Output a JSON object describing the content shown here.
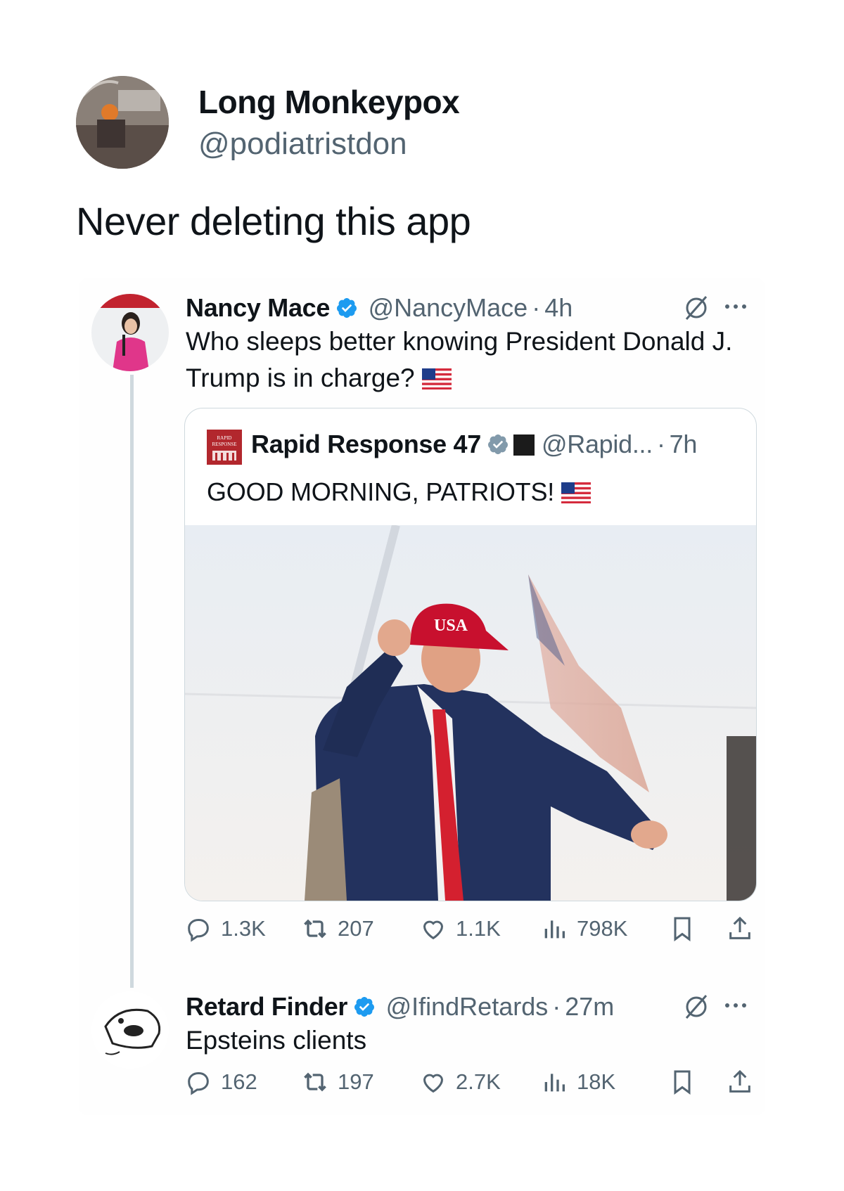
{
  "outer": {
    "display_name": "Long Monkeypox",
    "handle": "@podiatristdon",
    "text": "Never deleting this app"
  },
  "tweet1": {
    "display_name": "Nancy Mace",
    "handle": "@NancyMace",
    "time": "4h",
    "separator": "·",
    "text_line1": "Who sleeps better knowing President Donald J.",
    "text_line2": "Trump is in charge?",
    "quote": {
      "display_name": "Rapid Response 47",
      "handle": "@Rapid...",
      "time": "7h",
      "text": "GOOD MORNING, PATRIOTS!",
      "hat_text": "USA",
      "avatar_text": "RAPID RESPONSE"
    },
    "stats": {
      "replies": "1.3K",
      "reposts": "207",
      "likes": "1.1K",
      "views": "798K"
    }
  },
  "tweet2": {
    "display_name": "Retard Finder",
    "handle": "@IfindRetards",
    "time": "27m",
    "separator": "·",
    "text": "Epsteins clients",
    "stats": {
      "replies": "162",
      "reposts": "197",
      "likes": "2.7K",
      "views": "18K"
    }
  },
  "colors": {
    "verified_blue": "#1d9bf0",
    "muted": "#536471",
    "hat_red": "#c8102e",
    "tie_red": "#d4202f"
  },
  "icons": [
    "verified-badge-icon",
    "grok-icon",
    "more-icon",
    "reply-icon",
    "repost-icon",
    "like-icon",
    "views-icon",
    "bookmark-icon",
    "share-icon",
    "us-flag-icon"
  ]
}
